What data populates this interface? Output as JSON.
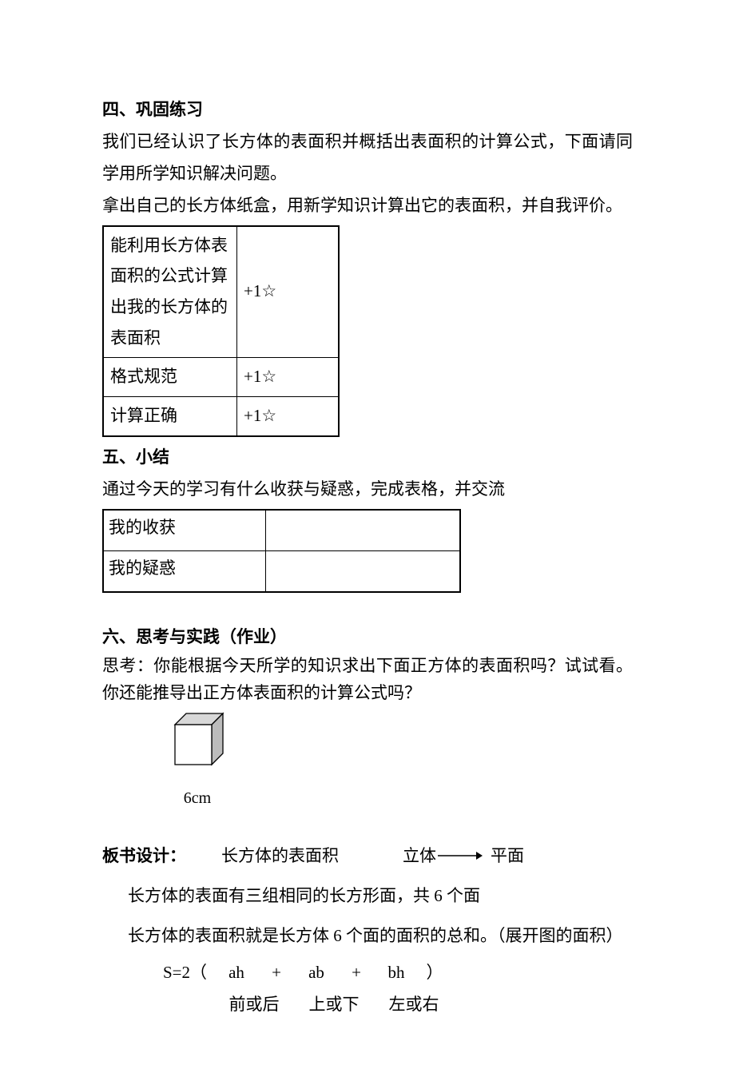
{
  "section4": {
    "heading": "四、巩固练习",
    "p1": "我们已经认识了长方体的表面积并概括出表面积的计算公式，下面请同学用所学知识解决问题。",
    "p2": "拿出自己的长方体纸盒，用新学知识计算出它的表面积，并自我评价。",
    "table": {
      "r1c1": "能利用长方体表面积的公式计算出我的长方体的表面积",
      "r1c2": "+1☆",
      "r2c1": "格式规范",
      "r2c2": "+1☆",
      "r3c1": "计算正确",
      "r3c2": "+1☆"
    }
  },
  "section5": {
    "heading": "五、小结",
    "p1": "通过今天的学习有什么收获与疑惑，完成表格，并交流",
    "table": {
      "r1c1": "我的收获",
      "r1c2": "",
      "r2c1": "我的疑惑",
      "r2c2": ""
    }
  },
  "section6": {
    "heading": "六、思考与实践（作业）",
    "p1": "思考：你能根据今天所学的知识求出下面正方体的表面积吗？试试看。你还能推导出正方体表面积的计算公式吗？",
    "cube_label": "6cm"
  },
  "boardDesign": {
    "label": "板书设计：",
    "title": "长方体的表面积",
    "solid": "立体",
    "plane": "平面",
    "line1": "长方体的表面有三组相同的长方形面，共 6 个面",
    "line2": "长方体的表面积就是长方体 6 个面的面积的总和。（展开图的面积）",
    "formula": {
      "S": "S=2（",
      "t1": "ah",
      "p1": "+",
      "t2": "ab",
      "p2": "+",
      "t3": "bh",
      "close": "）",
      "l1": "前或后",
      "l2": "上或下",
      "l3": "左或右"
    }
  }
}
